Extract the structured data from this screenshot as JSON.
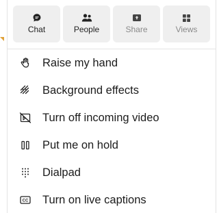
{
  "tabs": [
    {
      "label": "Chat",
      "icon": "chat-icon",
      "enabled": true
    },
    {
      "label": "People",
      "icon": "people-icon",
      "enabled": true
    },
    {
      "label": "Share",
      "icon": "share-icon",
      "enabled": false
    },
    {
      "label": "Views",
      "icon": "views-icon",
      "enabled": false
    }
  ],
  "items": [
    {
      "label": "Raise my hand",
      "icon": "raise-hand-icon"
    },
    {
      "label": "Background effects",
      "icon": "background-effects-icon"
    },
    {
      "label": "Turn off incoming video",
      "icon": "video-off-icon"
    },
    {
      "label": "Put me on hold",
      "icon": "pause-icon"
    },
    {
      "label": "Dialpad",
      "icon": "dialpad-icon"
    },
    {
      "label": "Turn on live captions",
      "icon": "captions-icon"
    }
  ],
  "colors": {
    "tab_bg": "#efefef",
    "text": "#1b1b1b",
    "disabled_text": "#8a8a8a",
    "accent_pointer": "#e0a23a"
  }
}
